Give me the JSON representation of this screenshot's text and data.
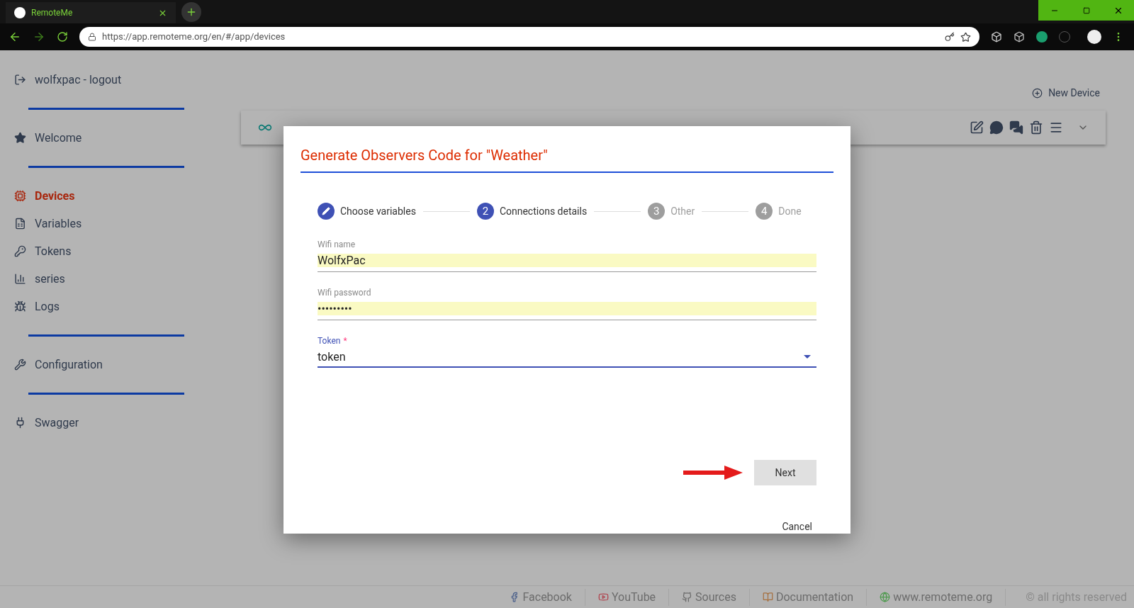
{
  "browser": {
    "tab_title": "RemoteMe",
    "url": "https://app.remoteme.org/en/#/app/devices"
  },
  "sidebar": {
    "groups": [
      [
        {
          "label": "wolfxpac - logout",
          "selected": false
        }
      ],
      [
        {
          "label": "Welcome",
          "selected": false
        }
      ],
      [
        {
          "label": "Devices",
          "selected": true
        },
        {
          "label": "Variables",
          "selected": false
        },
        {
          "label": "Tokens",
          "selected": false
        },
        {
          "label": "series",
          "selected": false
        },
        {
          "label": "Logs",
          "selected": false
        }
      ],
      [
        {
          "label": "Configuration",
          "selected": false
        }
      ],
      [
        {
          "label": "Swagger",
          "selected": false
        }
      ]
    ]
  },
  "new_device": "New Device",
  "dialog": {
    "title": "Generate Observers Code for \"Weather\"",
    "steps": [
      {
        "kind": "done",
        "label": "Choose variables"
      },
      {
        "kind": "active",
        "number": "2",
        "label": "Connections details"
      },
      {
        "kind": "pending",
        "number": "3",
        "label": "Other"
      },
      {
        "kind": "pending",
        "number": "4",
        "label": "Done"
      }
    ],
    "fields": [
      {
        "kind": "text",
        "label": "Wifi name",
        "value": "WolfxPac"
      },
      {
        "kind": "password",
        "label": "Wifi password",
        "value": "•••••••••"
      },
      {
        "kind": "select",
        "label": "Token",
        "required_mark": "*",
        "value": "token"
      }
    ],
    "next": "Next",
    "cancel": "Cancel"
  },
  "footer": [
    {
      "label": "Facebook"
    },
    {
      "label": "YouTube"
    },
    {
      "label": "Sources"
    },
    {
      "label": "Documentation"
    },
    {
      "label": "www.remoteme.org"
    }
  ],
  "copyright": "© all rights reserved"
}
